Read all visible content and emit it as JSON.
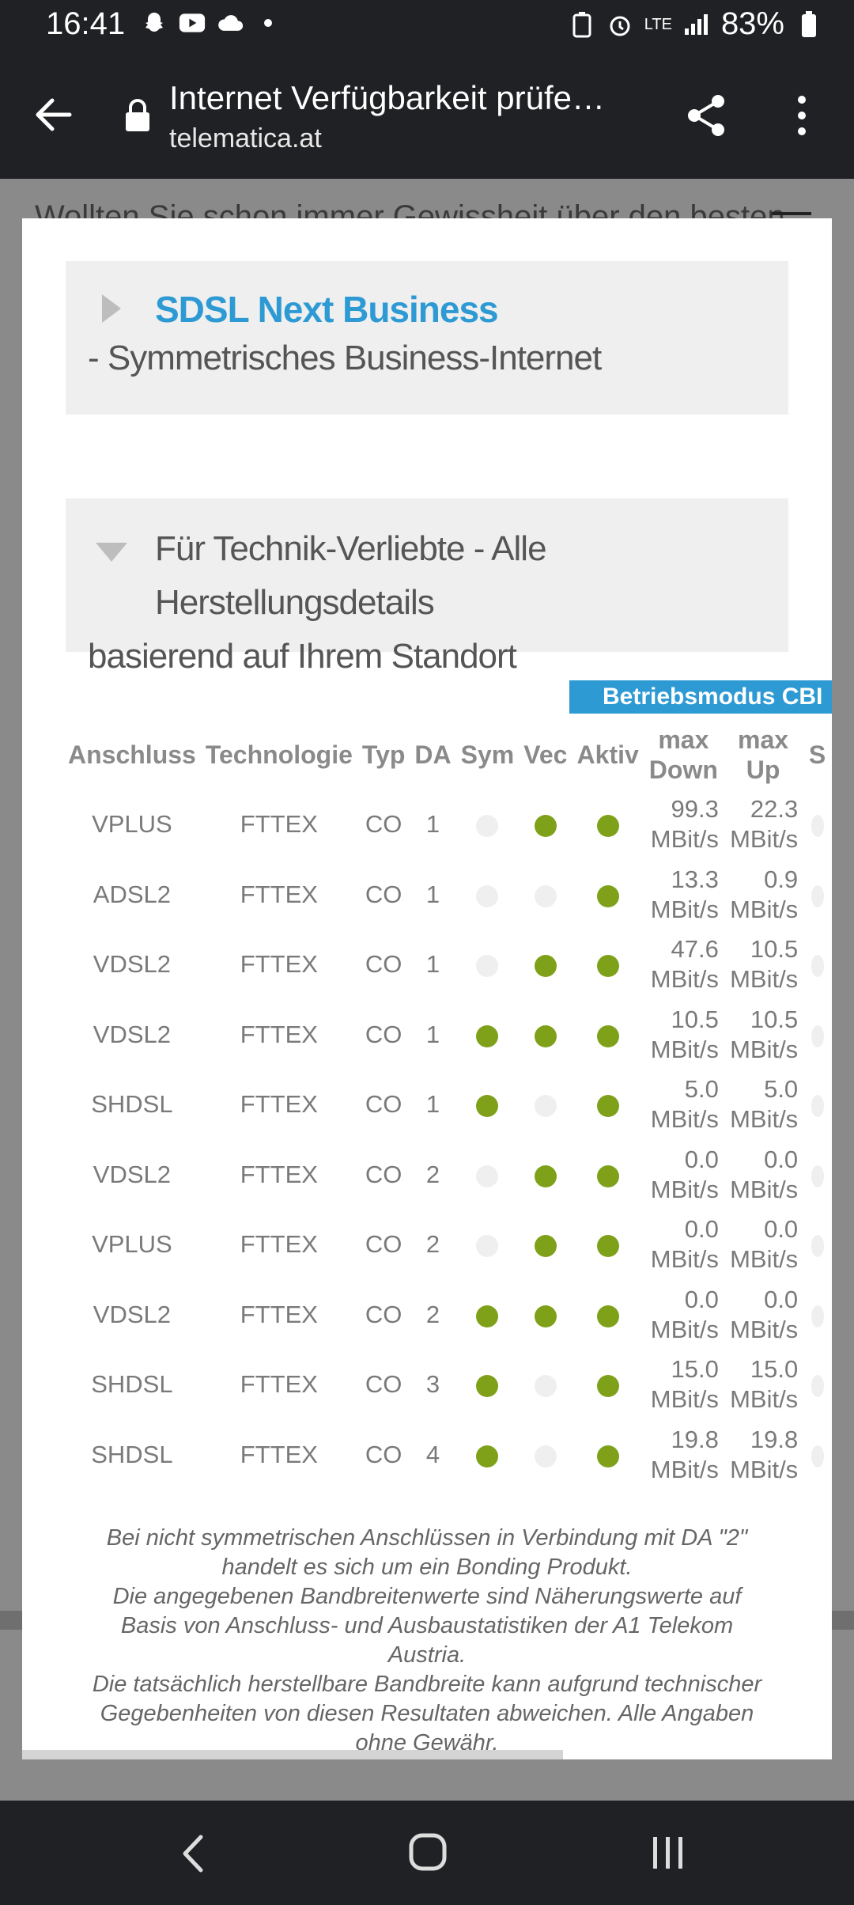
{
  "status_bar": {
    "time": "16:41",
    "network": "LTE",
    "battery": "83%",
    "left_icons": [
      "snapchat-icon",
      "youtube-icon",
      "cloud-icon",
      "dot-icon"
    ],
    "right_icons": [
      "battery-saver-icon",
      "alarm-icon",
      "lte-icon",
      "signal-icon",
      "battery-icon"
    ]
  },
  "toolbar": {
    "title": "Internet Verfügbarkeit prüfe…",
    "host": "telematica.at"
  },
  "background_page": {
    "peek_text": "Wollten Sie schon immer Gewissheit über den besten"
  },
  "modal": {
    "sdsl_card": {
      "link": "SDSL Next Business",
      "subtitle": "- Symmetrisches Business-Internet"
    },
    "tech_card": {
      "line1": "Für Technik-Verliebte - Alle Herstellungsdetails",
      "line2": "basierend auf Ihrem Standort"
    },
    "mode_tab": "Betriebsmodus CBI",
    "table": {
      "headers": {
        "anschluss": "Anschluss",
        "technologie": "Technologie",
        "typ": "Typ",
        "da": "DA",
        "sym": "Sym",
        "vec": "Vec",
        "aktiv": "Aktiv",
        "max_down_1": "max",
        "max_down_2": "Down",
        "max_up_1": "max",
        "max_up_2": "Up",
        "extra": "S"
      },
      "unit": "MBit/s",
      "rows": [
        {
          "anschluss": "VPLUS",
          "technologie": "FTTEX",
          "typ": "CO",
          "da": "1",
          "sym": false,
          "vec": true,
          "aktiv": true,
          "down": "99.3",
          "up": "22.3"
        },
        {
          "anschluss": "ADSL2",
          "technologie": "FTTEX",
          "typ": "CO",
          "da": "1",
          "sym": false,
          "vec": false,
          "aktiv": true,
          "down": "13.3",
          "up": "0.9"
        },
        {
          "anschluss": "VDSL2",
          "technologie": "FTTEX",
          "typ": "CO",
          "da": "1",
          "sym": false,
          "vec": true,
          "aktiv": true,
          "down": "47.6",
          "up": "10.5"
        },
        {
          "anschluss": "VDSL2",
          "technologie": "FTTEX",
          "typ": "CO",
          "da": "1",
          "sym": true,
          "vec": true,
          "aktiv": true,
          "down": "10.5",
          "up": "10.5"
        },
        {
          "anschluss": "SHDSL",
          "technologie": "FTTEX",
          "typ": "CO",
          "da": "1",
          "sym": true,
          "vec": false,
          "aktiv": true,
          "down": "5.0",
          "up": "5.0"
        },
        {
          "anschluss": "VDSL2",
          "technologie": "FTTEX",
          "typ": "CO",
          "da": "2",
          "sym": false,
          "vec": true,
          "aktiv": true,
          "down": "0.0",
          "up": "0.0"
        },
        {
          "anschluss": "VPLUS",
          "technologie": "FTTEX",
          "typ": "CO",
          "da": "2",
          "sym": false,
          "vec": true,
          "aktiv": true,
          "down": "0.0",
          "up": "0.0"
        },
        {
          "anschluss": "VDSL2",
          "technologie": "FTTEX",
          "typ": "CO",
          "da": "2",
          "sym": true,
          "vec": true,
          "aktiv": true,
          "down": "0.0",
          "up": "0.0"
        },
        {
          "anschluss": "SHDSL",
          "technologie": "FTTEX",
          "typ": "CO",
          "da": "3",
          "sym": true,
          "vec": false,
          "aktiv": true,
          "down": "15.0",
          "up": "15.0"
        },
        {
          "anschluss": "SHDSL",
          "technologie": "FTTEX",
          "typ": "CO",
          "da": "4",
          "sym": true,
          "vec": false,
          "aktiv": true,
          "down": "19.8",
          "up": "19.8"
        }
      ]
    },
    "note_lines": [
      "Bei nicht symmetrischen Anschlüssen in Verbindung mit DA \"2\"",
      "handelt es sich um ein Bonding Produkt.",
      "Die angegebenen Bandbreitenwerte sind Näherungswerte auf",
      "Basis von Anschluss- und Ausbaustatistiken der A1 Telekom",
      "Austria.",
      "Die tatsächlich herstellbare Bandbreite kann aufgrund technischer",
      "Gegebenheiten von diesen Resultaten abweichen. Alle Angaben",
      "ohne Gewähr."
    ]
  },
  "colors": {
    "accent": "#2e9ad4",
    "active_dot": "#7fa11a",
    "inactive_dot": "#efefef",
    "chrome": "#202124"
  }
}
